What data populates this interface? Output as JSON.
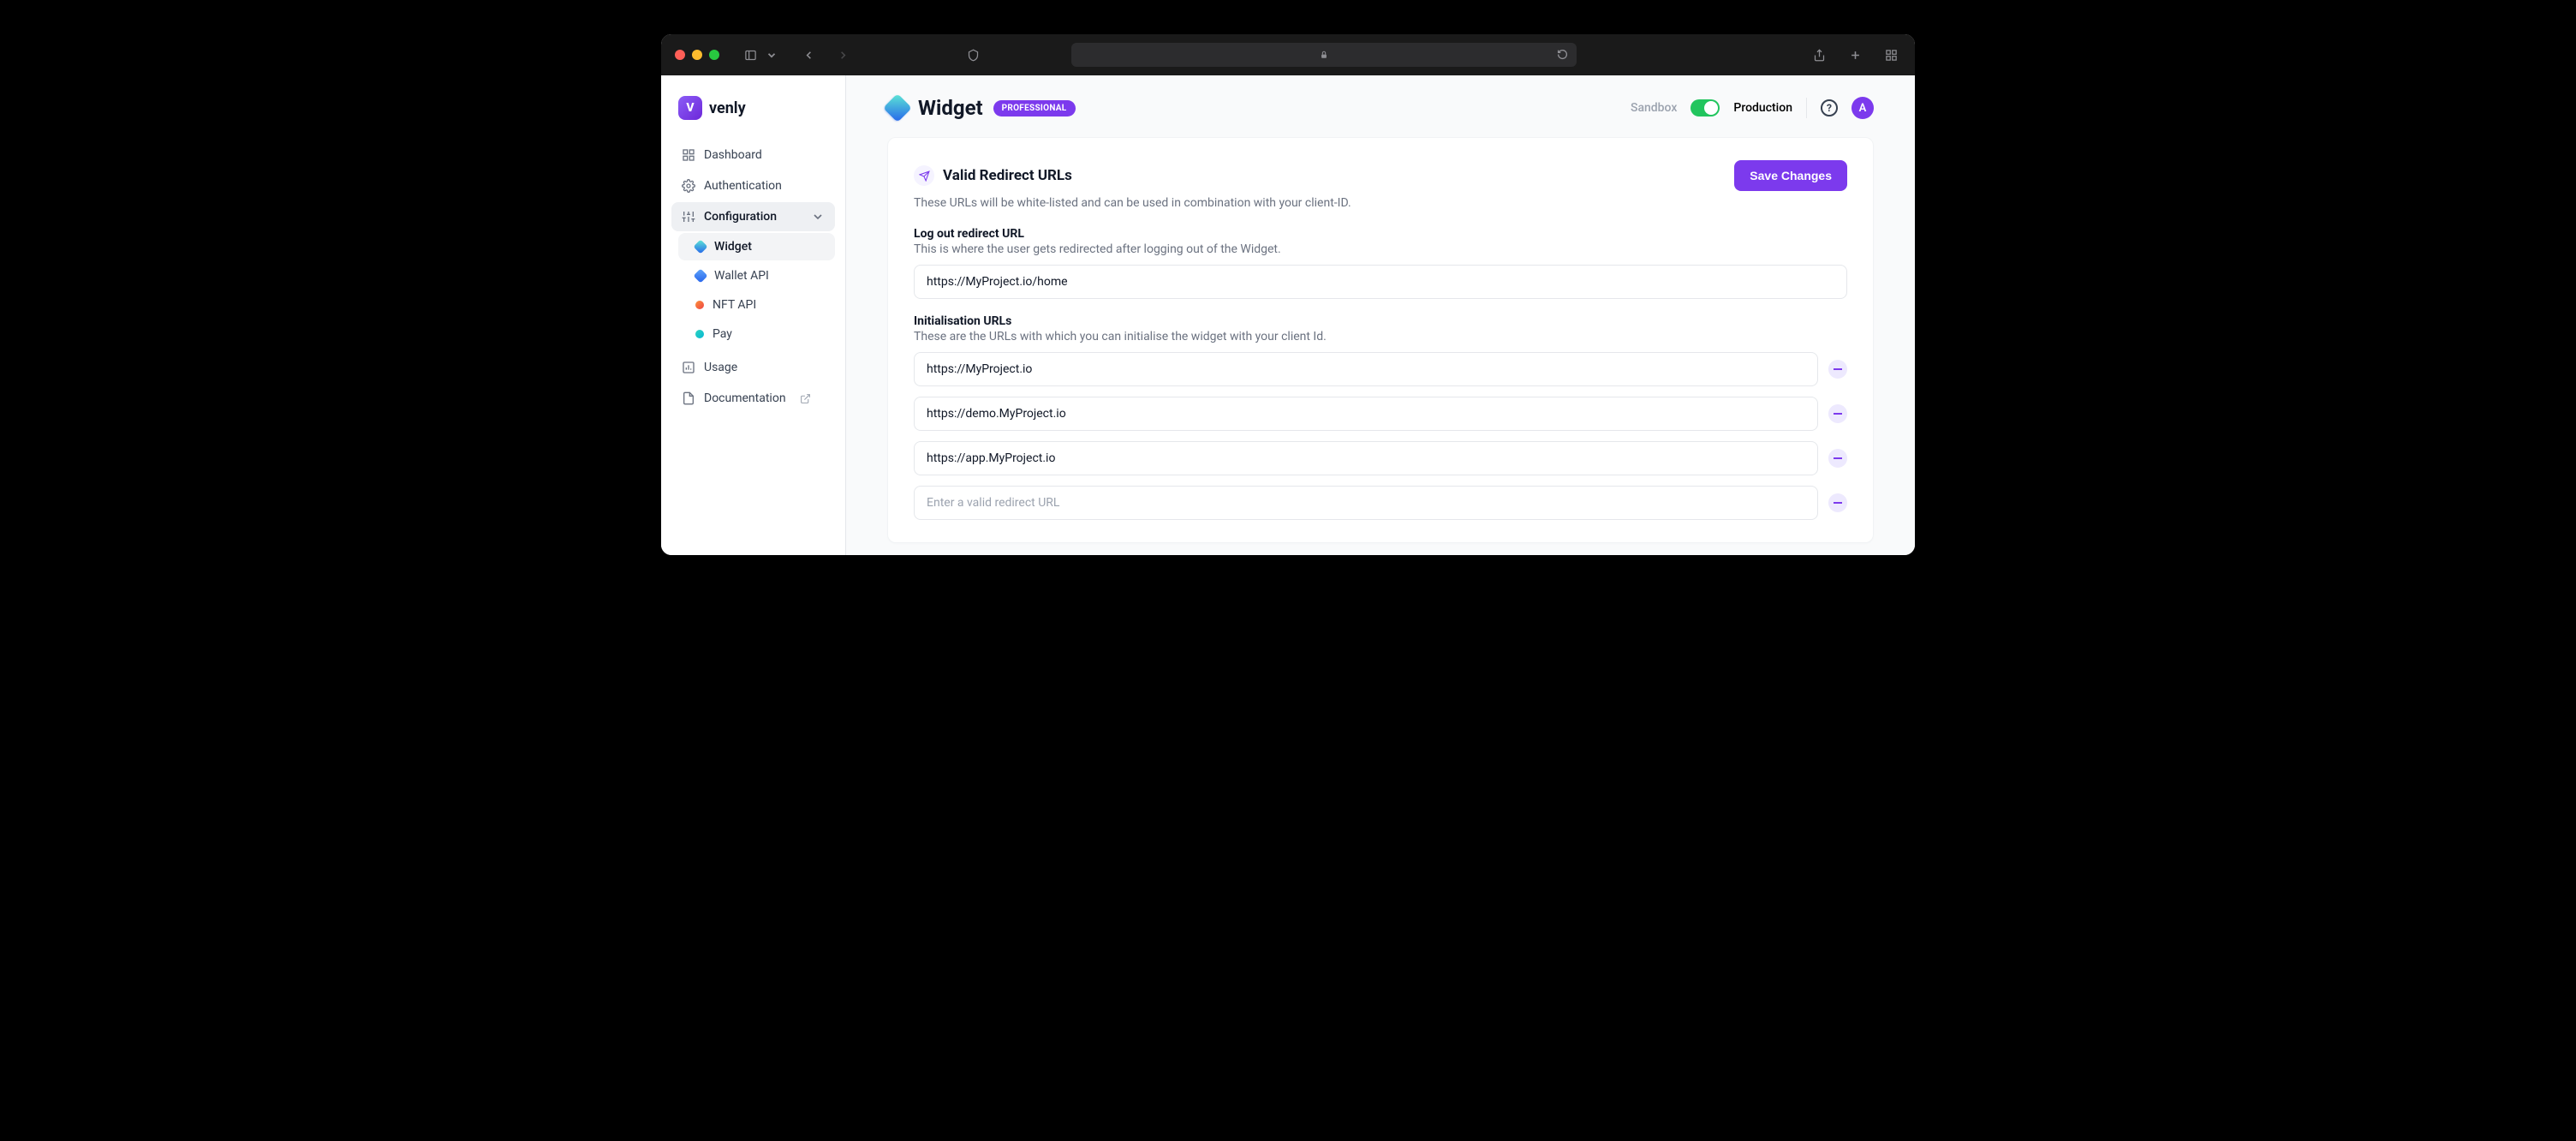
{
  "brand": {
    "name": "venly",
    "mark": "V"
  },
  "nav": {
    "dashboard": "Dashboard",
    "authentication": "Authentication",
    "configuration": "Configuration",
    "usage": "Usage",
    "documentation": "Documentation"
  },
  "subnav": {
    "widget": "Widget",
    "wallet_api": "Wallet API",
    "nft_api": "NFT API",
    "pay": "Pay"
  },
  "header": {
    "title": "Widget",
    "badge": "PROFESSIONAL",
    "env_sandbox": "Sandbox",
    "env_production": "Production",
    "help": "?",
    "avatar_initial": "A"
  },
  "card": {
    "title": "Valid Redirect URLs",
    "save_button": "Save Changes",
    "subtitle": "These URLs will be white-listed and can be used in combination with your client-ID."
  },
  "logout_section": {
    "label": "Log out redirect URL",
    "help": "This is where the user gets redirected after logging out of the Widget.",
    "value": "https://MyProject.io/home"
  },
  "init_section": {
    "label": "Initialisation URLs",
    "help": "These are the URLs with which you can initialise the widget with your client Id.",
    "urls": [
      "https://MyProject.io",
      "https://demo.MyProject.io",
      "https://app.MyProject.io"
    ],
    "placeholder": "Enter a valid redirect URL"
  }
}
